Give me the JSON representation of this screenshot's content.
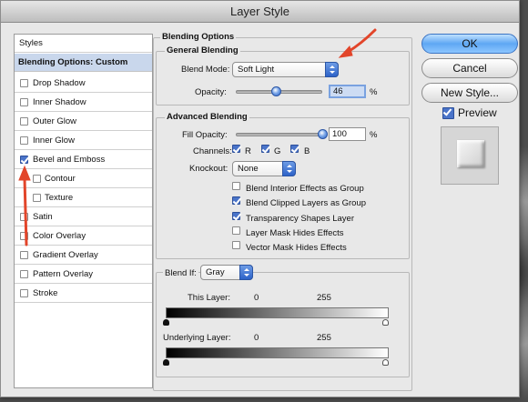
{
  "window": {
    "title": "Layer Style"
  },
  "styles_panel": {
    "header": "Styles",
    "selected": "Blending Options: Custom",
    "items": [
      {
        "label": "Drop Shadow",
        "checked": false
      },
      {
        "label": "Inner Shadow",
        "checked": false
      },
      {
        "label": "Outer Glow",
        "checked": false
      },
      {
        "label": "Inner Glow",
        "checked": false
      },
      {
        "label": "Bevel and Emboss",
        "checked": true
      },
      {
        "label": "Contour",
        "checked": false
      },
      {
        "label": "Texture",
        "checked": false
      },
      {
        "label": "Satin",
        "checked": false
      },
      {
        "label": "Color Overlay",
        "checked": false
      },
      {
        "label": "Gradient Overlay",
        "checked": false
      },
      {
        "label": "Pattern Overlay",
        "checked": false
      },
      {
        "label": "Stroke",
        "checked": false
      }
    ]
  },
  "blending_options": {
    "title": "Blending Options",
    "general": {
      "title": "General Blending",
      "blend_mode_label": "Blend Mode:",
      "blend_mode_value": "Soft Light",
      "opacity_label": "Opacity:",
      "opacity_value": "46",
      "opacity_unit": "%",
      "opacity_fraction": 0.46
    },
    "advanced": {
      "title": "Advanced Blending",
      "fill_opacity_label": "Fill Opacity:",
      "fill_opacity_value": "100",
      "fill_opacity_unit": "%",
      "channels_label": "Channels:",
      "channels": [
        {
          "label": "R",
          "checked": true
        },
        {
          "label": "G",
          "checked": true
        },
        {
          "label": "B",
          "checked": true
        }
      ],
      "knockout_label": "Knockout:",
      "knockout_value": "None",
      "options": [
        {
          "label": "Blend Interior Effects as Group",
          "checked": false
        },
        {
          "label": "Blend Clipped Layers as Group",
          "checked": true
        },
        {
          "label": "Transparency Shapes Layer",
          "checked": true
        },
        {
          "label": "Layer Mask Hides Effects",
          "checked": false
        },
        {
          "label": "Vector Mask Hides Effects",
          "checked": false
        }
      ]
    },
    "blend_if": {
      "label": "Blend If:",
      "value": "Gray",
      "this_layer_label": "This Layer:",
      "this_layer_min": "0",
      "this_layer_max": "255",
      "underlying_label": "Underlying Layer:",
      "underlying_min": "0",
      "underlying_max": "255"
    }
  },
  "buttons": {
    "ok": "OK",
    "cancel": "Cancel",
    "new_style": "New Style...",
    "preview_label": "Preview",
    "preview_checked": true
  },
  "colors": {
    "accent": "#4a74c9",
    "annotation_arrow": "#e2452a",
    "selected_row": "#c9d7ec"
  }
}
